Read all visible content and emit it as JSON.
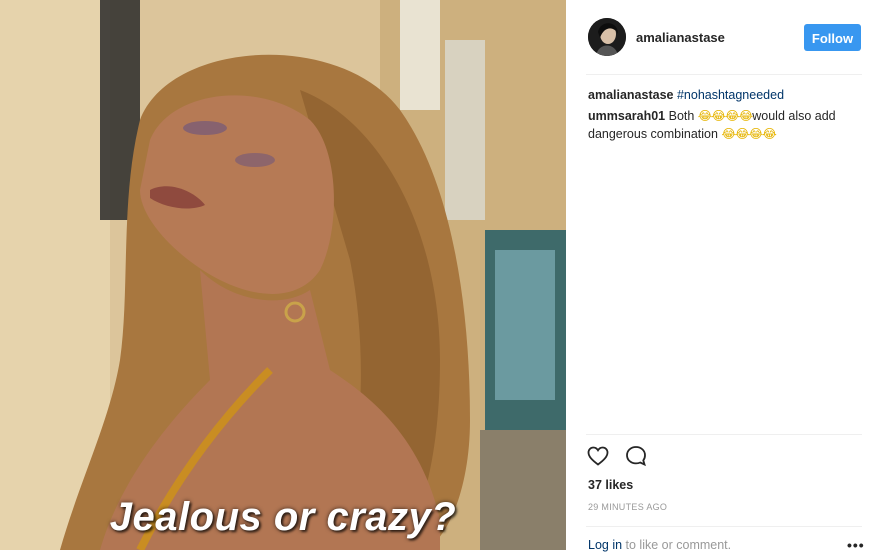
{
  "photo": {
    "overlay_caption": "Jealous or crazy?"
  },
  "header": {
    "username": "amalianastase",
    "follow_label": "Follow"
  },
  "comments": [
    {
      "user": "amalianastase",
      "hashtag": "#nohashtagneeded"
    },
    {
      "user": "ummsarah01",
      "text_before": "Both ",
      "emoji_1": "😂😂😂😂",
      "text_mid": "would also add dangerous combination ",
      "emoji_2": "😂😂😂😂"
    }
  ],
  "actions": {
    "like_icon": "heart-icon",
    "comment_icon": "comment-bubble-icon"
  },
  "likes": "37 likes",
  "timestamp": "29 MINUTES AGO",
  "login": {
    "link": "Log in",
    "rest": " to like or comment."
  },
  "more_icon": "more-options-icon",
  "colors": {
    "follow_button": "#3897f0",
    "hashtag": "#003569",
    "muted": "#999999"
  }
}
